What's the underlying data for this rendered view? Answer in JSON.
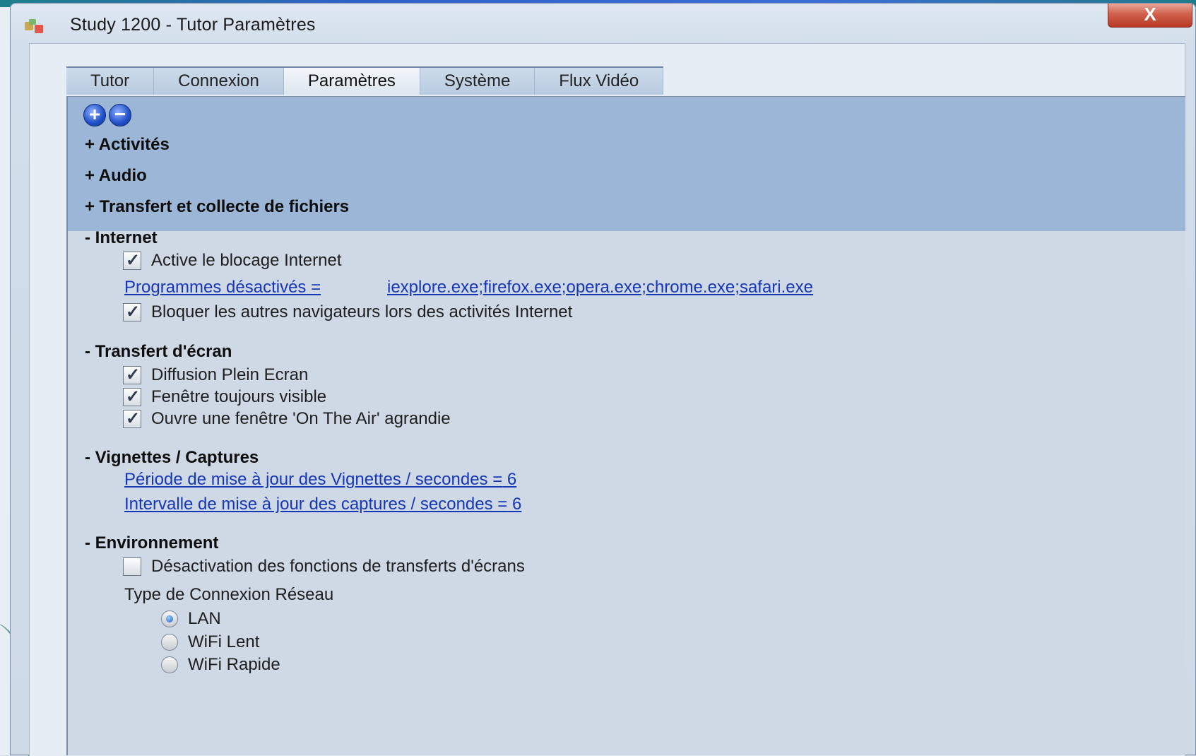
{
  "window": {
    "title": "Study 1200 - Tutor Paramètres",
    "close_label": "X"
  },
  "tabs": [
    {
      "label": "Tutor",
      "active": false
    },
    {
      "label": "Connexion",
      "active": false
    },
    {
      "label": "Paramètres",
      "active": true
    },
    {
      "label": "Système",
      "active": false
    },
    {
      "label": "Flux Vidéo",
      "active": false
    }
  ],
  "toolbar": {
    "expand_label": "+",
    "collapse_label": "−"
  },
  "collapsed_sections": [
    "+ Activités",
    "+ Audio",
    "+ Transfert et collecte de fichiers"
  ],
  "internet": {
    "heading": "- Internet",
    "block_label": "Active le blocage Internet",
    "block_checked": true,
    "programs_label": "Programmes désactivés =",
    "programs_value": "iexplore.exe;firefox.exe;opera.exe;chrome.exe;safari.exe",
    "block_browsers_label": "Bloquer les autres navigateurs lors des activités Internet",
    "block_browsers_checked": true
  },
  "screen_transfer": {
    "heading": "- Transfert d'écran",
    "options": [
      {
        "label": "Diffusion Plein Ecran",
        "checked": true
      },
      {
        "label": "Fenêtre toujours visible",
        "checked": true
      },
      {
        "label": "Ouvre une fenêtre 'On The Air' agrandie",
        "checked": true
      }
    ]
  },
  "thumbnails": {
    "heading": "- Vignettes / Captures",
    "period_label": "Période de mise à jour des Vignettes / secondes =",
    "period_value": "6",
    "interval_label": "Intervalle de mise à jour des captures / secondes =",
    "interval_value": "6"
  },
  "environment": {
    "heading": "- Environnement",
    "disable_label": "Désactivation des fonctions de transferts d'écrans",
    "disable_checked": false,
    "network_label": "Type de Connexion Réseau",
    "network_options": [
      {
        "label": "LAN",
        "selected": true
      },
      {
        "label": "WiFi Lent",
        "selected": false
      },
      {
        "label": "WiFi Rapide",
        "selected": false
      }
    ]
  }
}
